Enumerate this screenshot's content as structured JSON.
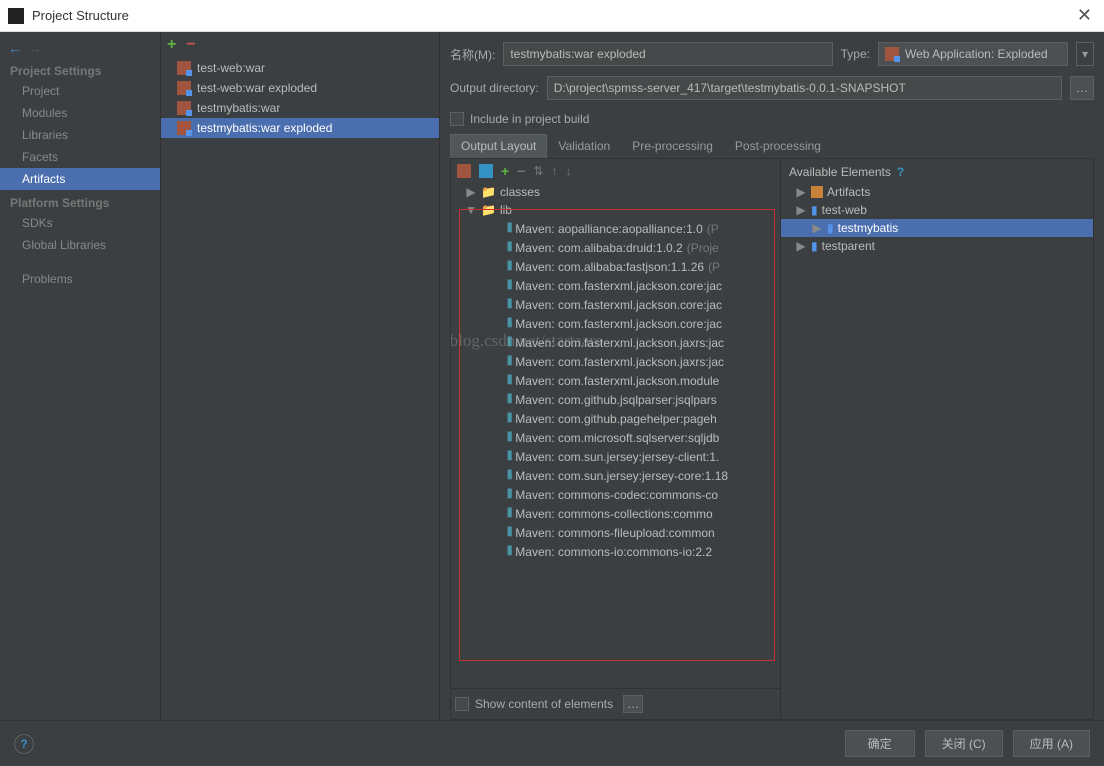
{
  "window": {
    "title": "Project Structure"
  },
  "nav": {
    "section1": "Project Settings",
    "items1": [
      "Project",
      "Modules",
      "Libraries",
      "Facets",
      "Artifacts"
    ],
    "section2": "Platform Settings",
    "items2": [
      "SDKs",
      "Global Libraries"
    ],
    "problems": "Problems",
    "selected": "Artifacts"
  },
  "artifacts": {
    "items": [
      "test-web:war",
      "test-web:war exploded",
      "testmybatis:war",
      "testmybatis:war exploded"
    ],
    "selected": "testmybatis:war exploded"
  },
  "form": {
    "name_label": "名称(M):",
    "name_value": "testmybatis:war exploded",
    "type_label": "Type:",
    "type_value": "Web Application: Exploded",
    "outdir_label": "Output directory:",
    "outdir_value": "D:\\project\\spmss-server_417\\target\\testmybatis-0.0.1-SNAPSHOT",
    "include_label": "Include in project build"
  },
  "tabs": [
    "Output Layout",
    "Validation",
    "Pre-processing",
    "Post-processing"
  ],
  "tabs_active": "Output Layout",
  "output_tree": {
    "root_classes": "classes",
    "root_lib": "lib",
    "libs": [
      {
        "t": "Maven: aopalliance:aopalliance:1.0",
        "s": "(P"
      },
      {
        "t": "Maven: com.alibaba:druid:1.0.2",
        "s": "(Proje"
      },
      {
        "t": "Maven: com.alibaba:fastjson:1.1.26",
        "s": "(P"
      },
      {
        "t": "Maven: com.fasterxml.jackson.core:jac",
        "s": ""
      },
      {
        "t": "Maven: com.fasterxml.jackson.core:jac",
        "s": ""
      },
      {
        "t": "Maven: com.fasterxml.jackson.core:jac",
        "s": ""
      },
      {
        "t": "Maven: com.fasterxml.jackson.jaxrs:jac",
        "s": ""
      },
      {
        "t": "Maven: com.fasterxml.jackson.jaxrs:jac",
        "s": ""
      },
      {
        "t": "Maven: com.fasterxml.jackson.module",
        "s": ""
      },
      {
        "t": "Maven: com.github.jsqlparser:jsqlpars",
        "s": ""
      },
      {
        "t": "Maven: com.github.pagehelper:pageh",
        "s": ""
      },
      {
        "t": "Maven: com.microsoft.sqlserver:sqljdb",
        "s": ""
      },
      {
        "t": "Maven: com.sun.jersey:jersey-client:1.",
        "s": ""
      },
      {
        "t": "Maven: com.sun.jersey:jersey-core:1.18",
        "s": ""
      },
      {
        "t": "Maven: commons-codec:commons-co",
        "s": ""
      },
      {
        "t": "Maven: commons-collections:commo",
        "s": ""
      },
      {
        "t": "Maven: commons-fileupload:common",
        "s": ""
      },
      {
        "t": "Maven: commons-io:commons-io:2.2",
        "s": ""
      }
    ]
  },
  "show_content": "Show content of elements",
  "available": {
    "header": "Available Elements",
    "items": [
      {
        "label": "Artifacts",
        "type": "art",
        "indent": 1
      },
      {
        "label": "test-web",
        "type": "mod",
        "indent": 1
      },
      {
        "label": "testmybatis",
        "type": "mod",
        "indent": 2,
        "selected": true
      },
      {
        "label": "testparent",
        "type": "mod",
        "indent": 1
      }
    ]
  },
  "footer": {
    "ok": "确定",
    "close": "关闭 (C)",
    "apply": "应用 (A)"
  },
  "watermark": "http://blog.csdn.net/startaara"
}
